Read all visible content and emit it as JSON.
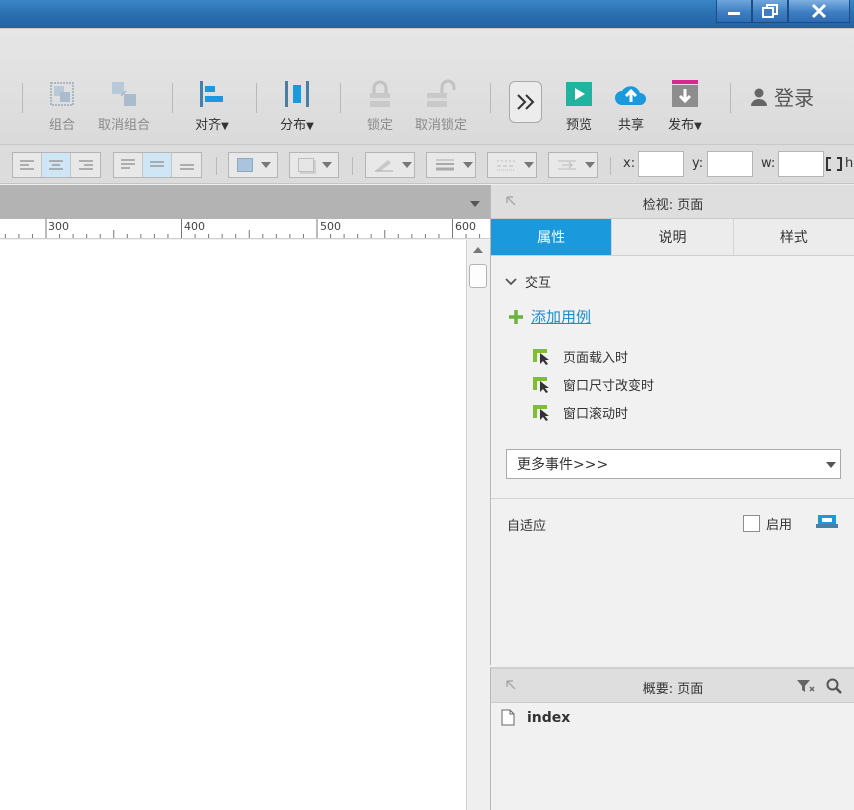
{
  "toolbar": {
    "group": "组合",
    "ungroup": "取消组合",
    "align": "对齐",
    "distribute": "分布",
    "lock": "锁定",
    "unlock": "取消锁定",
    "preview": "预览",
    "share": "共享",
    "publish": "发布",
    "login": "登录",
    "dropdown_arrow": "▼"
  },
  "coords": {
    "x": "x:",
    "y": "y:",
    "w": "w:",
    "h": "h"
  },
  "ruler": {
    "ticks": [
      "300",
      "400",
      "500",
      "600"
    ]
  },
  "inspector": {
    "title": "检视: 页面",
    "tabs": [
      "属性",
      "说明",
      "样式"
    ],
    "interaction_title": "交互",
    "add_case": "添加用例",
    "events": [
      "页面载入时",
      "窗口尺寸改变时",
      "窗口滚动时"
    ],
    "more_events": "更多事件>>>",
    "adaptive": "自适应",
    "enable": "启用"
  },
  "outline": {
    "title": "概要: 页面",
    "pages": [
      "index"
    ]
  },
  "colors": {
    "accent": "#1a99dc",
    "link": "#1a8ecf",
    "event_icon": "#7cbf2f",
    "publish_bar": "#d6288f"
  }
}
